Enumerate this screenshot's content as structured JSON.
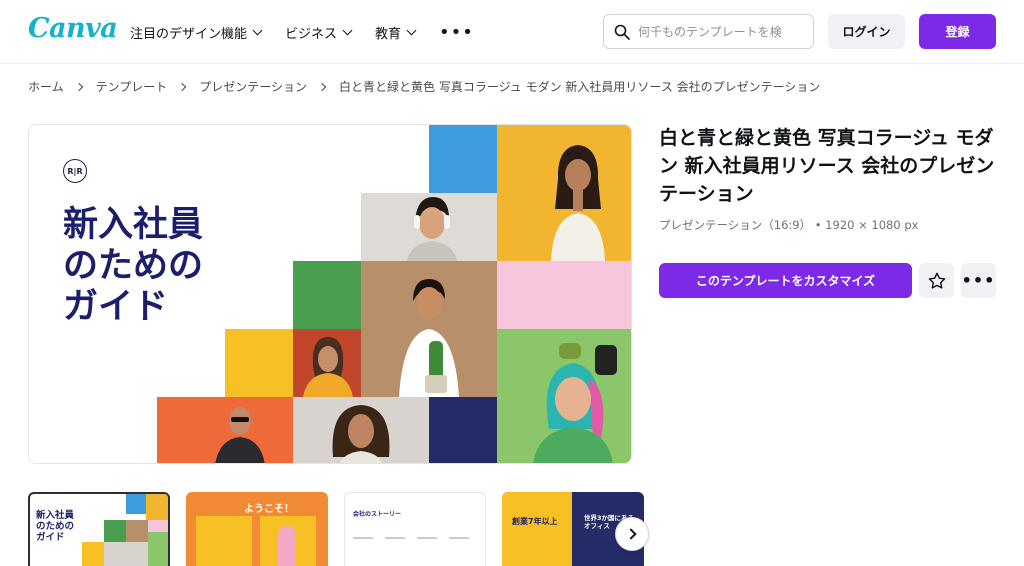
{
  "header": {
    "logo": "Canva",
    "nav": [
      {
        "label": "注目のデザイン機能"
      },
      {
        "label": "ビジネス"
      },
      {
        "label": "教育"
      }
    ],
    "search_placeholder": "何千ものテンプレートを検",
    "login_label": "ログイン",
    "signup_label": "登録"
  },
  "breadcrumb": {
    "items": [
      "ホーム",
      "テンプレート",
      "プレゼンテーション"
    ],
    "current": "白と青と緑と黄色 写真コラージュ モダン 新入社員用リソース 会社のプレゼンテーション"
  },
  "preview": {
    "logo_text": "R|R",
    "title": "新入社員\nのための\nガイド"
  },
  "template": {
    "title": "白と青と緑と黄色 写真コラージュ モダン 新入社員用リソース 会社のプレゼンテーション",
    "meta": "プレゼンテーション（16:9） • 1920 × 1080 px",
    "customize_label": "このテンプレートをカスタマイズ"
  },
  "thumbnails": {
    "items": [
      {
        "title": "新入社員\nのための\nガイド"
      },
      {
        "title": "ようこそ！"
      },
      {
        "title": "会社のストーリー"
      },
      {
        "title": "創業7年以上"
      }
    ],
    "extra_text": "世界3か国にある\nオフィス"
  },
  "colors": {
    "brand_purple": "#7d2ae8",
    "logo_teal": "#16b2c9",
    "navy": "#1b1f6b"
  },
  "icons": [
    "search-icon",
    "chevron-down-icon",
    "more-icon",
    "chevron-right-icon",
    "star-icon"
  ]
}
